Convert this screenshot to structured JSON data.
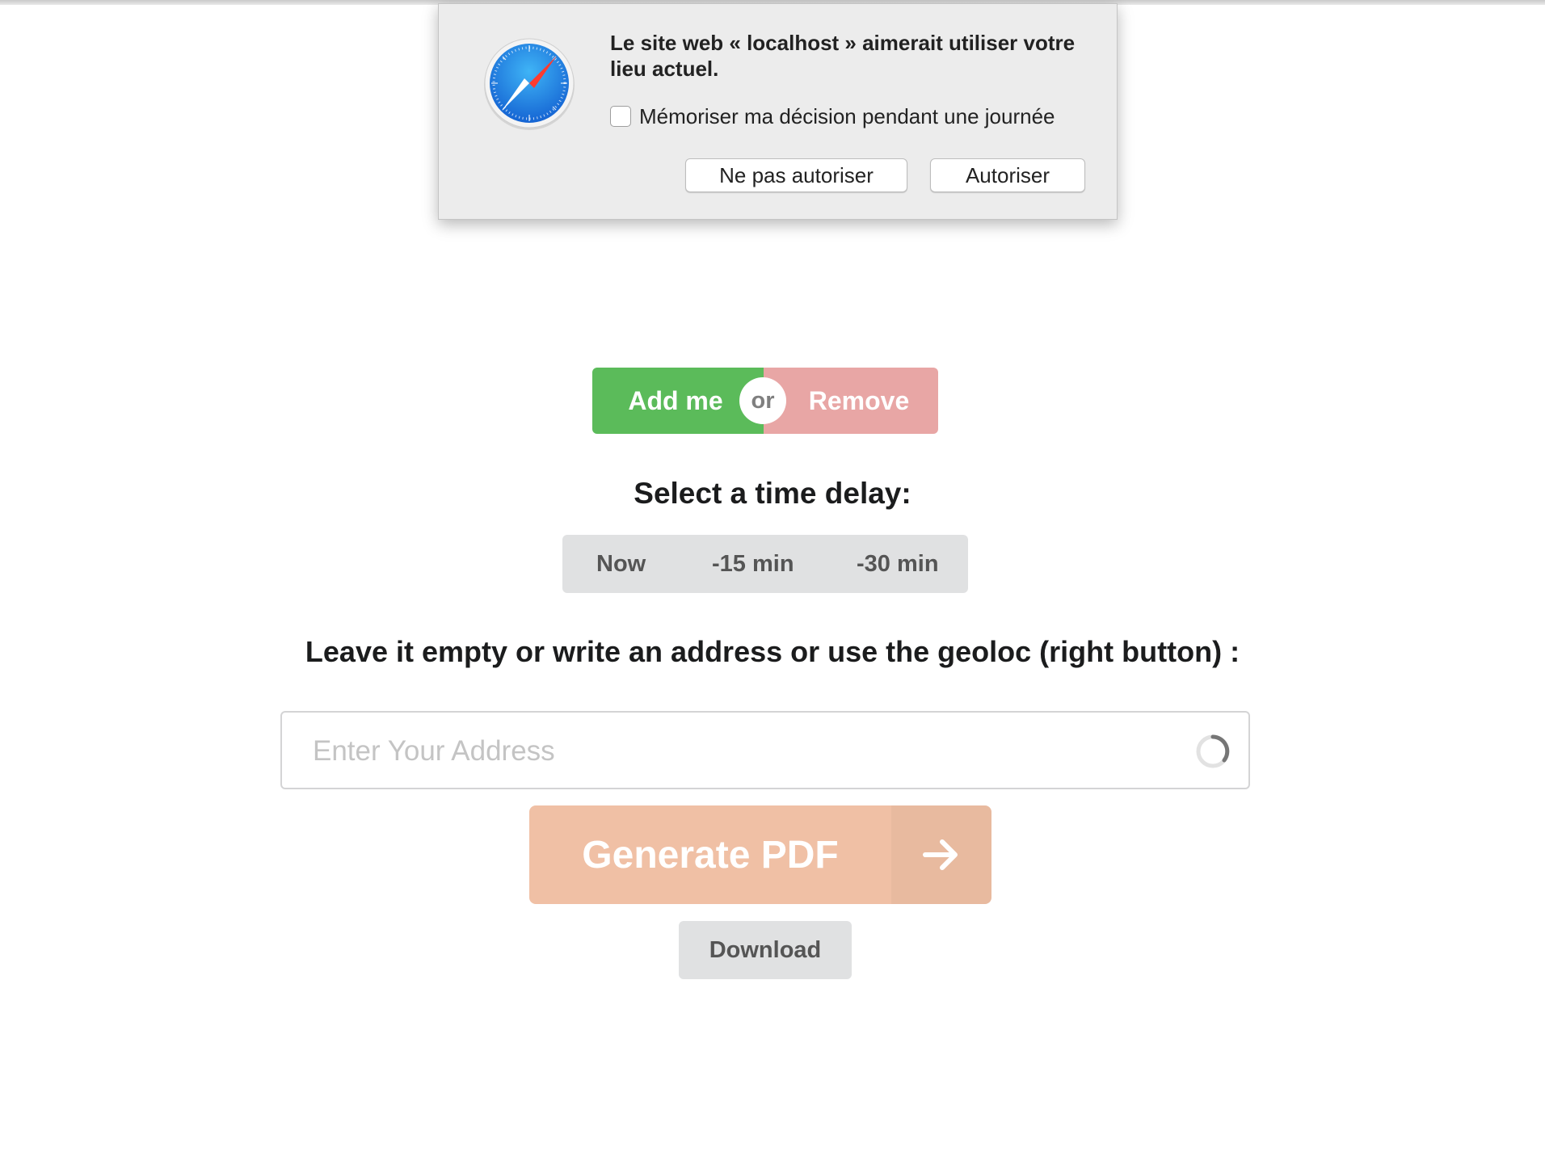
{
  "permission_dialog": {
    "message": "Le site web « localhost » aimerait utiliser votre lieu actuel.",
    "remember_label": "Mémoriser ma décision pendant une journée",
    "remember_checked": false,
    "deny_label": "Ne pas autoriser",
    "allow_label": "Autoriser",
    "icon": "safari-compass-icon"
  },
  "action_toggle": {
    "add_label": "Add me",
    "or_label": "or",
    "remove_label": "Remove",
    "add_color": "#5bbb5a",
    "remove_color": "#e8a6a5"
  },
  "time_delay": {
    "heading": "Select a time delay:",
    "options": [
      "Now",
      "-15 min",
      "-30 min"
    ]
  },
  "address": {
    "heading": "Leave it empty or write an address or use the geoloc (right button) :",
    "placeholder": "Enter Your Address",
    "value": "",
    "geoloc_icon": "loading-spinner-icon"
  },
  "generate": {
    "label": "Generate PDF",
    "icon": "arrow-right-icon",
    "color": "#f0c0a5"
  },
  "download": {
    "label": "Download"
  }
}
